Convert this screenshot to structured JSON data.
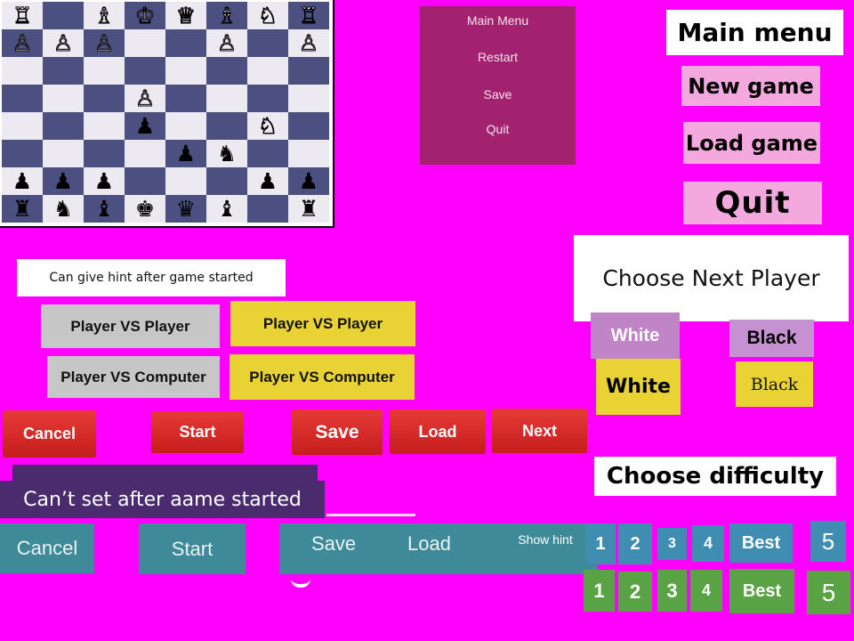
{
  "board": {
    "rows": [
      [
        "wR",
        "",
        "wB",
        "wK",
        "wQ",
        "wB",
        "wN",
        "wR"
      ],
      [
        "wP",
        "wP",
        "wP",
        "",
        "",
        "wP",
        "",
        "wP"
      ],
      [
        "",
        "",
        "",
        "",
        "",
        "",
        "",
        ""
      ],
      [
        "",
        "",
        "",
        "wP",
        "",
        "",
        "",
        ""
      ],
      [
        "",
        "",
        "",
        "bP",
        "",
        "",
        "wN",
        ""
      ],
      [
        "",
        "",
        "",
        "",
        "bP",
        "bN",
        "",
        ""
      ],
      [
        "bP",
        "bP",
        "bP",
        "",
        "",
        "",
        "bP",
        "bP"
      ],
      [
        "bR",
        "bN",
        "bB",
        "bK",
        "bQ",
        "bB",
        "",
        "bR"
      ]
    ],
    "glyphs": {
      "wK": "♔",
      "wQ": "♕",
      "wR": "♖",
      "wB": "♗",
      "wN": "♘",
      "wP": "♙",
      "bK": "♚",
      "bQ": "♛",
      "bR": "♜",
      "bB": "♝",
      "bN": "♞",
      "bP": "♟"
    }
  },
  "purple_menu": {
    "main_menu": "Main Menu",
    "restart": "Restart",
    "save": "Save",
    "quit": "Quit"
  },
  "main_menu": {
    "title": "Main menu",
    "new_game": "New game",
    "load_game": "Load game",
    "quit": "Quit"
  },
  "hint_label": "Can give hint after game started",
  "modes": {
    "pvp": "Player VS Player",
    "pvc": "Player VS Computer"
  },
  "next_player": {
    "title": "Choose Next Player",
    "white": "White",
    "black": "Black"
  },
  "red_buttons": {
    "cancel": "Cancel",
    "start": "Start",
    "save": "Save",
    "load": "Load",
    "next": "Next"
  },
  "cant_set": "Can’t set after aame started",
  "teal_buttons": {
    "cancel": "Cancel",
    "start": "Start",
    "save": "Save",
    "load": "Load",
    "show_hint": "Show hint"
  },
  "difficulty": {
    "title": "Choose difficulty",
    "teal_levels": [
      "1",
      "2",
      "3",
      "4",
      "Best",
      "5"
    ],
    "green_levels": [
      "1",
      "2",
      "3",
      "4",
      "Best",
      "5"
    ]
  },
  "colors": {
    "background": "#ff00ff",
    "board_dark": "#4b5081",
    "board_light": "#eceaf0",
    "purple_menu": "#a2226f",
    "red_button": "#d42a27",
    "teal_button": "#3e8a98",
    "yellow_button": "#e9d234",
    "green_level": "#5aa344"
  }
}
